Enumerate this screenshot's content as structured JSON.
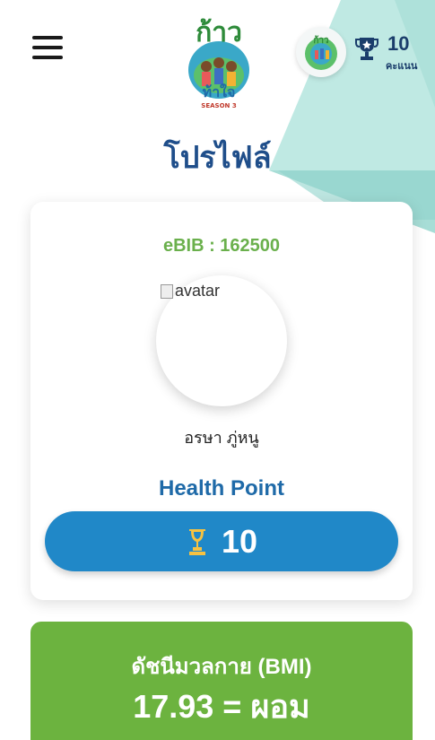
{
  "header": {
    "menu_icon": "hamburger-menu-icon",
    "logo_icon": "kaotumjai-season-logo-icon",
    "points_value": "10",
    "points_unit": "คะแนน",
    "trophy_icon": "trophy-icon"
  },
  "page": {
    "title": "โปรไฟล์"
  },
  "profile": {
    "ebib": "eBIB : 162500",
    "avatar_alt": "avatar",
    "name": "อรษา ภู่หนู",
    "health_point_label": "Health Point",
    "health_point_value": "10"
  },
  "bmi": {
    "label": "ดัชนีมวลกาย (BMI)",
    "value": "17.93 = ผอม"
  },
  "colors": {
    "primary_blue": "#2088c8",
    "title_blue": "#1f4e8a",
    "accent_green": "#6cb33f",
    "ebib_green": "#6ab04c",
    "teal_decor": "#9fdcd5"
  }
}
